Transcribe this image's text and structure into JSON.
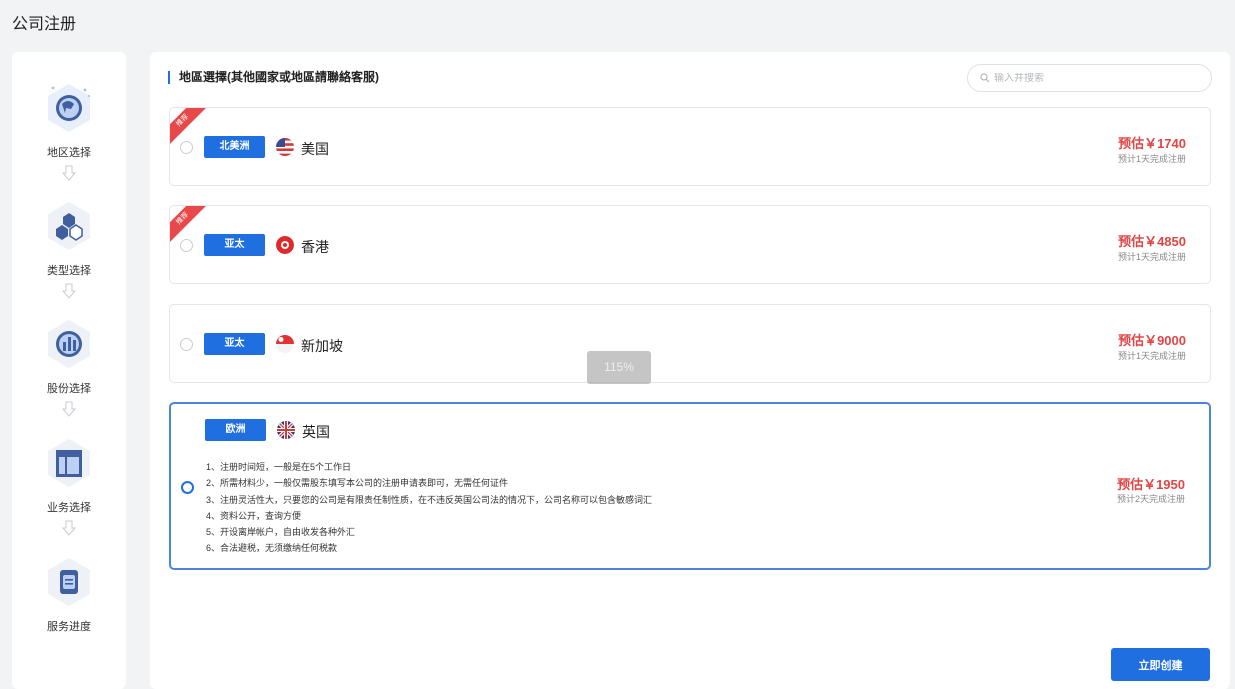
{
  "page_title": "公司注册",
  "steps": [
    {
      "label": "地区选择",
      "icon": "globe-icon"
    },
    {
      "label": "类型选择",
      "icon": "cubes-icon"
    },
    {
      "label": "股份选择",
      "icon": "pie-chart-icon"
    },
    {
      "label": "业务选择",
      "icon": "layout-icon"
    },
    {
      "label": "服务进度",
      "icon": "document-icon"
    }
  ],
  "section_title": "地區選擇(其他國家或地區請聯絡客服)",
  "search": {
    "placeholder": "输入并搜索"
  },
  "regions": [
    {
      "tag": "北美洲",
      "country": "美国",
      "price": "预估￥1740",
      "eta": "预计1天完成注册",
      "ribbon": "推荐",
      "selected": false
    },
    {
      "tag": "亚太",
      "country": "香港",
      "price": "预估￥4850",
      "eta": "预计1天完成注册",
      "ribbon": "推荐",
      "selected": false
    },
    {
      "tag": "亚太",
      "country": "新加坡",
      "price": "预估￥9000",
      "eta": "预计1天完成注册",
      "selected": false
    },
    {
      "tag": "欧洲",
      "country": "英国",
      "price": "预估￥1950",
      "eta": "预计2天完成注册",
      "selected": true,
      "details": [
        "1、注册时间短，一般是在5个工作日",
        "2、所需材料少，一般仅需股东填写本公司的注册申请表即可，无需任何证件",
        "3、注册灵活性大，只要您的公司是有限责任制性质，在不违反英国公司法的情况下，公司名称可以包含敏感词汇",
        "4、资料公开，查询方便",
        "5、开设离岸帐户，自由收发各种外汇",
        "6、合法避税，无须缴纳任何税款"
      ]
    }
  ],
  "zoom_level": "115%",
  "create_button": "立即创建",
  "colors": {
    "accent": "#1f6fe0",
    "price": "#e24545",
    "ribbon": "#e84848"
  }
}
